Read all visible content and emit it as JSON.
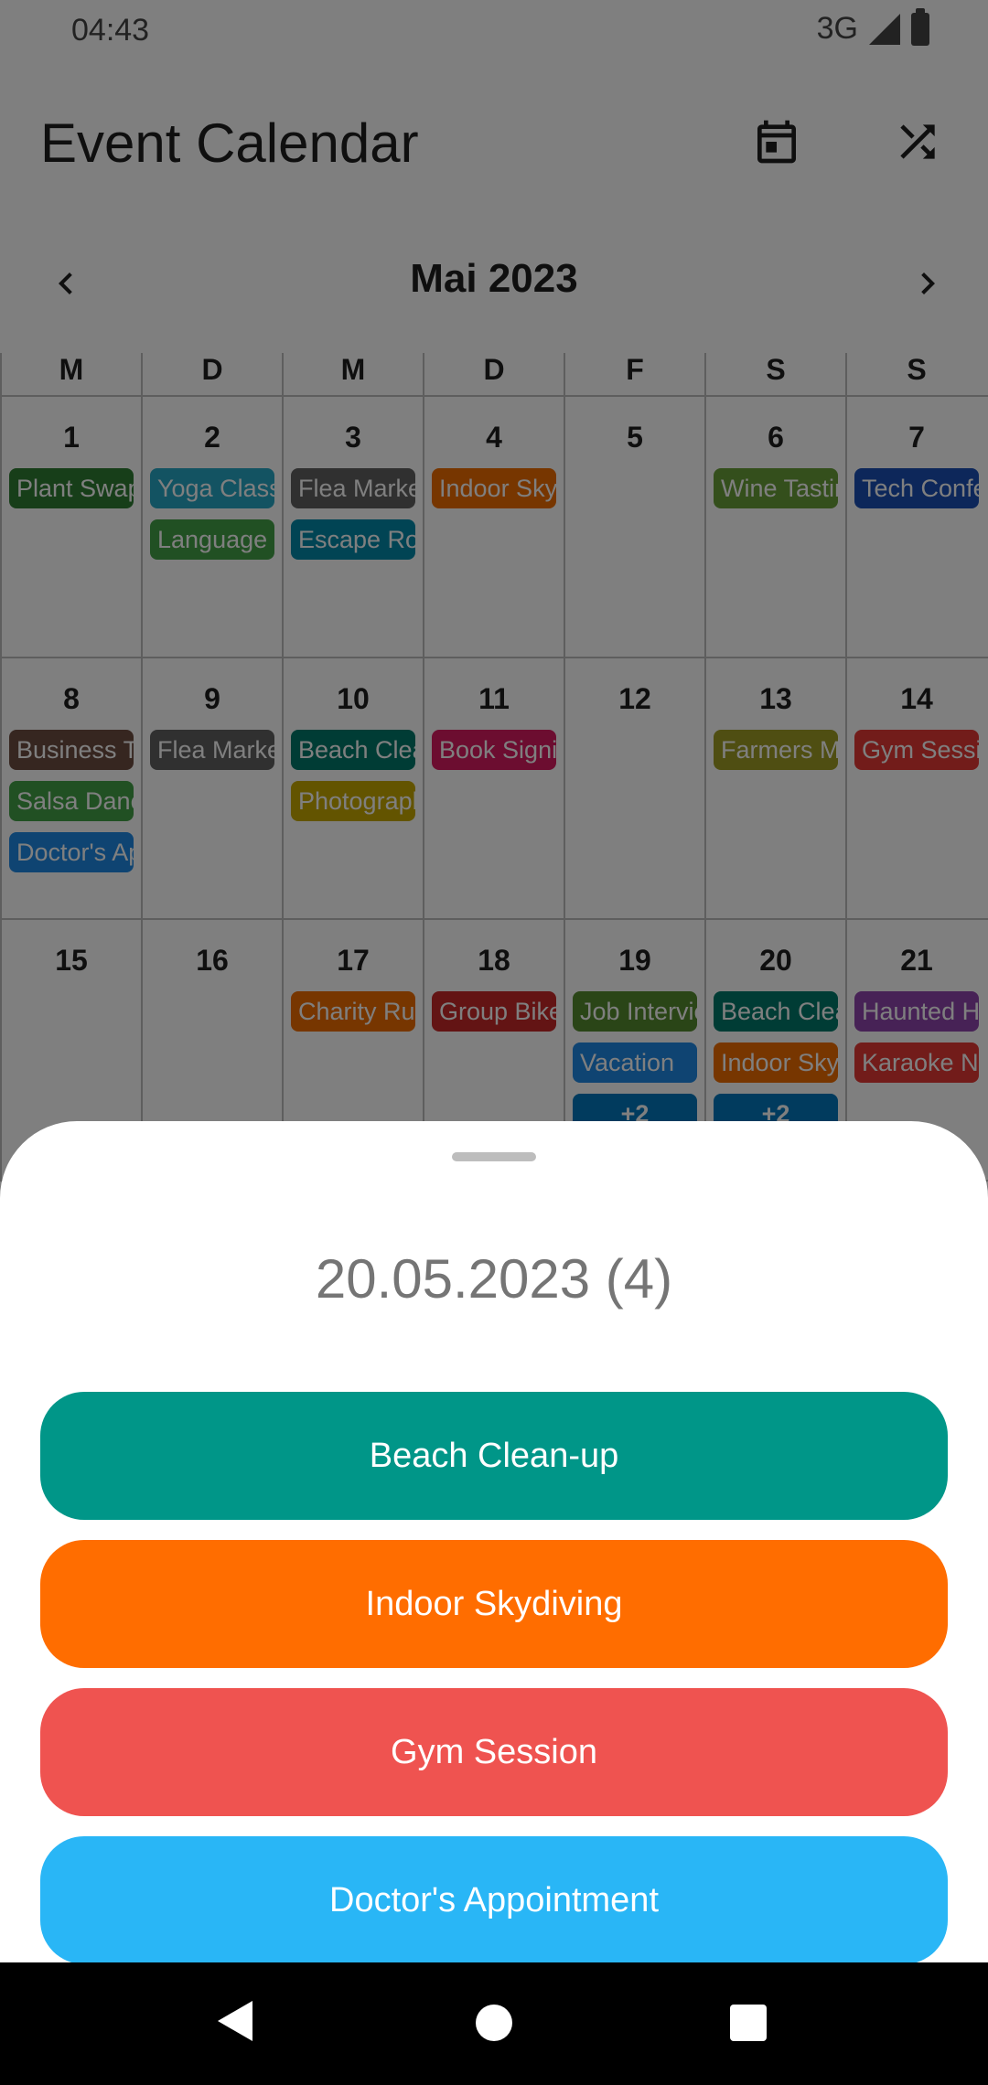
{
  "status": {
    "time": "04:43",
    "network": "3G"
  },
  "appbar": {
    "title": "Event Calendar",
    "icons": [
      "calendar-today-icon",
      "shuffle-icon"
    ]
  },
  "month": {
    "label": "Mai 2023"
  },
  "weekdays": [
    "M",
    "D",
    "M",
    "D",
    "F",
    "S",
    "S"
  ],
  "weeks": [
    [
      {
        "day": "1",
        "events": [
          {
            "label": "Plant Swap",
            "color": "#2e7d32"
          }
        ]
      },
      {
        "day": "2",
        "events": [
          {
            "label": "Yoga Class",
            "color": "#26a6c4"
          },
          {
            "label": "Language",
            "color": "#43a047"
          }
        ]
      },
      {
        "day": "3",
        "events": [
          {
            "label": "Flea Market",
            "color": "#616161"
          },
          {
            "label": "Escape Room",
            "color": "#0288a8"
          }
        ]
      },
      {
        "day": "4",
        "events": [
          {
            "label": "Indoor Skydiving",
            "color": "#ef6c00"
          }
        ]
      },
      {
        "day": "5",
        "events": []
      },
      {
        "day": "6",
        "events": [
          {
            "label": "Wine Tasting",
            "color": "#689f38"
          }
        ]
      },
      {
        "day": "7",
        "events": [
          {
            "label": "Tech Conference",
            "color": "#1a4fb5"
          }
        ]
      }
    ],
    [
      {
        "day": "8",
        "events": [
          {
            "label": "Business Talk",
            "color": "#6d4c41"
          },
          {
            "label": "Salsa Dance",
            "color": "#43a047"
          },
          {
            "label": "Doctor's Appointment",
            "color": "#1e88e5"
          }
        ]
      },
      {
        "day": "9",
        "events": [
          {
            "label": "Flea Market",
            "color": "#616161"
          }
        ]
      },
      {
        "day": "10",
        "events": [
          {
            "label": "Beach Clean-up",
            "color": "#00796b"
          },
          {
            "label": "Photography",
            "color": "#c7a800"
          }
        ]
      },
      {
        "day": "11",
        "events": [
          {
            "label": "Book Signing",
            "color": "#d81b60"
          }
        ]
      },
      {
        "day": "12",
        "events": []
      },
      {
        "day": "13",
        "events": [
          {
            "label": "Farmers Market",
            "color": "#9e9d24"
          }
        ]
      },
      {
        "day": "14",
        "events": [
          {
            "label": "Gym Session",
            "color": "#e53935"
          }
        ]
      }
    ],
    [
      {
        "day": "15",
        "events": []
      },
      {
        "day": "16",
        "events": []
      },
      {
        "day": "17",
        "events": [
          {
            "label": "Charity Run",
            "color": "#ef6c00"
          }
        ]
      },
      {
        "day": "18",
        "events": [
          {
            "label": "Group Bike",
            "color": "#c62828"
          }
        ]
      },
      {
        "day": "19",
        "events": [
          {
            "label": "Job Interview",
            "color": "#558b2f"
          },
          {
            "label": "Vacation",
            "color": "#1e88e5"
          },
          {
            "label": "+2",
            "color": "#0277bd",
            "more": true
          }
        ]
      },
      {
        "day": "20",
        "events": [
          {
            "label": "Beach Clean-up",
            "color": "#00796b"
          },
          {
            "label": "Indoor Skydiving",
            "color": "#ef6c00"
          },
          {
            "label": "+2",
            "color": "#0277bd",
            "more": true
          }
        ]
      },
      {
        "day": "21",
        "events": [
          {
            "label": "Haunted House",
            "color": "#8e44ad"
          },
          {
            "label": "Karaoke Night",
            "color": "#e53935"
          }
        ]
      }
    ]
  ],
  "sheet": {
    "title": "20.05.2023 (4)",
    "events": [
      {
        "label": "Beach Clean-up",
        "color": "#009688"
      },
      {
        "label": "Indoor Skydiving",
        "color": "#ff6d00"
      },
      {
        "label": "Gym Session",
        "color": "#ef5350"
      },
      {
        "label": "Doctor's Appointment",
        "color": "#29b6f6"
      }
    ]
  }
}
